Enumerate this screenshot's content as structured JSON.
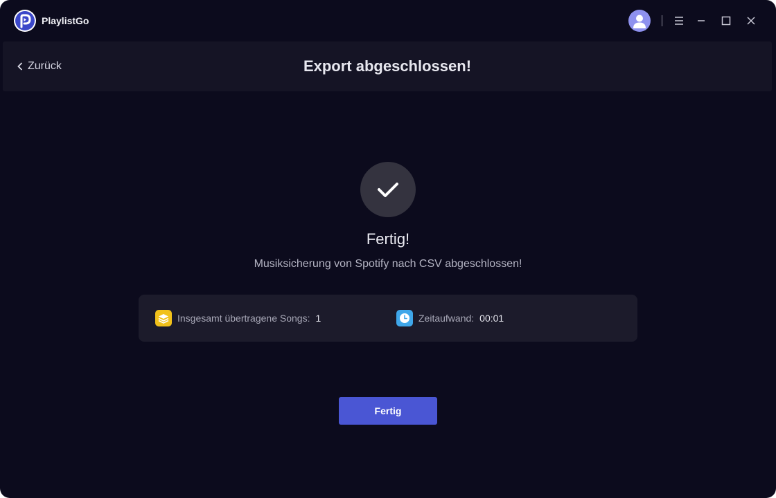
{
  "app": {
    "name": "PlaylistGo",
    "icons": {
      "logo": "playlistgo-logo-icon",
      "avatar": "user-avatar-icon",
      "menu": "menu-icon",
      "minimize": "minimize-icon",
      "maximize": "maximize-icon",
      "close": "close-icon"
    }
  },
  "header": {
    "back_label": "Zurück",
    "back_icon": "chevron-left-icon",
    "title": "Export abgeschlossen!"
  },
  "result": {
    "status_icon": "check-icon",
    "title": "Fertig!",
    "subtitle": "Musiksicherung von Spotify nach CSV abgeschlossen!"
  },
  "stats": {
    "songs": {
      "icon": "layers-icon",
      "label": "Insgesamt übertragene Songs:",
      "value": "1"
    },
    "time": {
      "icon": "clock-icon",
      "label": "Zeitaufwand:",
      "value": "00:01"
    }
  },
  "actions": {
    "done_label": "Fertig"
  },
  "colors": {
    "background": "#0c0b1d",
    "panel": "#151425",
    "accent": "#4a56d4",
    "avatar": "#8e91ee",
    "songs_icon": "#f1c11b",
    "time_icon": "#3fa7ea"
  }
}
